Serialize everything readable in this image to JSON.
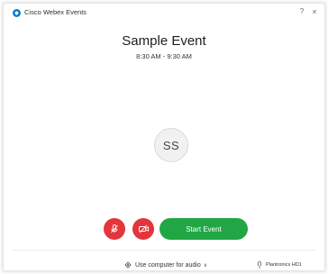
{
  "window": {
    "app_title": "Cisco Webex Events",
    "help_glyph": "?",
    "close_glyph": "×"
  },
  "event": {
    "title": "Sample Event",
    "time": "8:30 AM - 9:30 AM"
  },
  "avatar": {
    "initials": "SS"
  },
  "controls": {
    "mute_icon": "microphone-muted-icon",
    "video_icon": "camera-off-icon",
    "start_label": "Start Event",
    "start_color": "#21a645",
    "danger_color": "#e5353c"
  },
  "footer": {
    "audio_label": "Use computer for audio",
    "audio_chevron": "∨",
    "device_label": "Plantronics HD1"
  }
}
